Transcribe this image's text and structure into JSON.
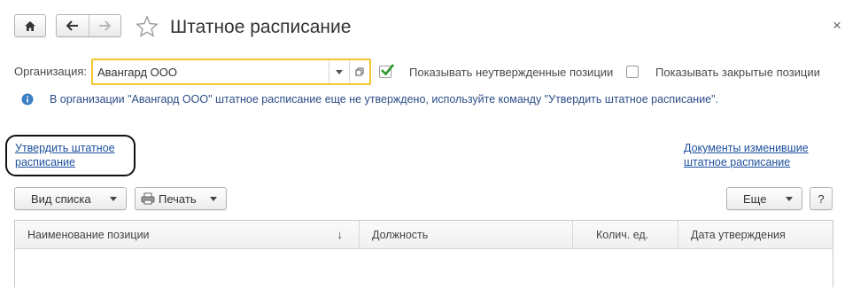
{
  "window": {
    "title": "Штатное расписание",
    "close_glyph": "×"
  },
  "filters": {
    "organization_label": "Организация:",
    "organization_value": "Авангард ООО",
    "show_unapproved_label": "Показывать неутвержденные позиции",
    "show_unapproved_checked": true,
    "show_closed_label": "Показывать закрытые позиции",
    "show_closed_checked": false
  },
  "info": {
    "message": "В организации \"Авангард ООО\" штатное расписание еще не утверждено, используйте команду \"Утвердить штатное расписание\"."
  },
  "links": {
    "approve_line1": "Утвердить штатное",
    "approve_line2": "расписание",
    "documents_line1": "Документы изменившие",
    "documents_line2": "штатное расписание"
  },
  "toolbar": {
    "view_list_label": "Вид списка",
    "print_label": "Печать",
    "more_label": "Еще",
    "help_label": "?"
  },
  "table": {
    "columns": [
      {
        "label": "Наименование позиции",
        "sort": "↓"
      },
      {
        "label": "Должность"
      },
      {
        "label": "Колич. ед."
      },
      {
        "label": "Дата утверждения"
      }
    ]
  },
  "colors": {
    "accent_field_border": "#f2c62e",
    "link": "#1c4f9c",
    "info_icon": "#3d7fc6",
    "check_green": "#2e9a2e"
  }
}
